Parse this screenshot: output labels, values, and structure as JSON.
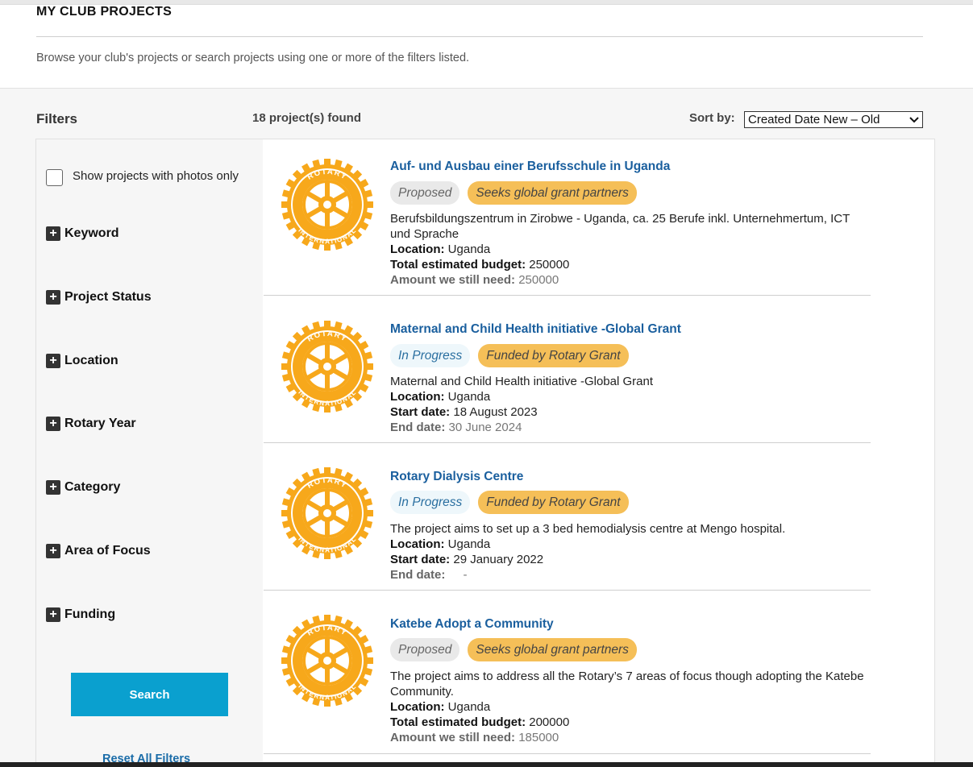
{
  "header": {
    "title": "MY CLUB PROJECTS",
    "description": "Browse your club's projects or search projects using one or more of the filters listed."
  },
  "toolbar": {
    "filters_title": "Filters",
    "found": "18 project(s) found",
    "sort_label": "Sort by:",
    "sort_value": "Created Date New – Old"
  },
  "sidebar": {
    "photos_only": "Show projects with photos only",
    "filters": [
      "Keyword",
      "Project Status",
      "Location",
      "Rotary Year",
      "Category",
      "Area of Focus",
      "Funding"
    ],
    "search_label": "Search",
    "reset_label": "Reset All Filters"
  },
  "projects": [
    {
      "title": "Auf- und Ausbau einer Berufsschule in Uganda",
      "status": "Proposed",
      "funding": "Seeks global grant partners",
      "description": "Berufsbildungszentrum in Zirobwe - Uganda, ca. 25 Berufe inkl. Unternehmertum, ICT und Sprache",
      "location_label": "Location:",
      "location": "Uganda",
      "f1_label": "Total estimated budget:",
      "f1": "250000",
      "f2_label": "Amount we still need:",
      "f2": "250000"
    },
    {
      "title": "Maternal and Child Health initiative -Global Grant",
      "status": "In Progress",
      "funding": "Funded by Rotary Grant",
      "description": "Maternal and Child Health initiative -Global Grant",
      "location_label": "Location:",
      "location": "Uganda",
      "f1_label": "Start date:",
      "f1": "18 August 2023",
      "f2_label": "End date:",
      "f2": "30 June 2024"
    },
    {
      "title": "Rotary Dialysis Centre",
      "status": "In Progress",
      "funding": "Funded by Rotary Grant",
      "description": "The project aims to set up a 3 bed hemodialysis centre at Mengo hospital.",
      "location_label": "Location:",
      "location": "Uganda",
      "f1_label": "Start date:",
      "f1": "29 January 2022",
      "f2_label": "End date:",
      "f2": "-"
    },
    {
      "title": "Katebe Adopt a Community",
      "status": "Proposed",
      "funding": "Seeks global grant partners",
      "description": "The project aims to address all the Rotary’s 7 areas of focus though adopting the Katebe Community.",
      "location_label": "Location:",
      "location": "Uganda",
      "f1_label": "Total estimated budget:",
      "f1": "200000",
      "f2_label": "Amount we still need:",
      "f2": "185000"
    }
  ],
  "logo": {
    "top_text": "ROTARY",
    "bottom_text": "INTERNATIONAL",
    "color": "#f7a81b"
  }
}
